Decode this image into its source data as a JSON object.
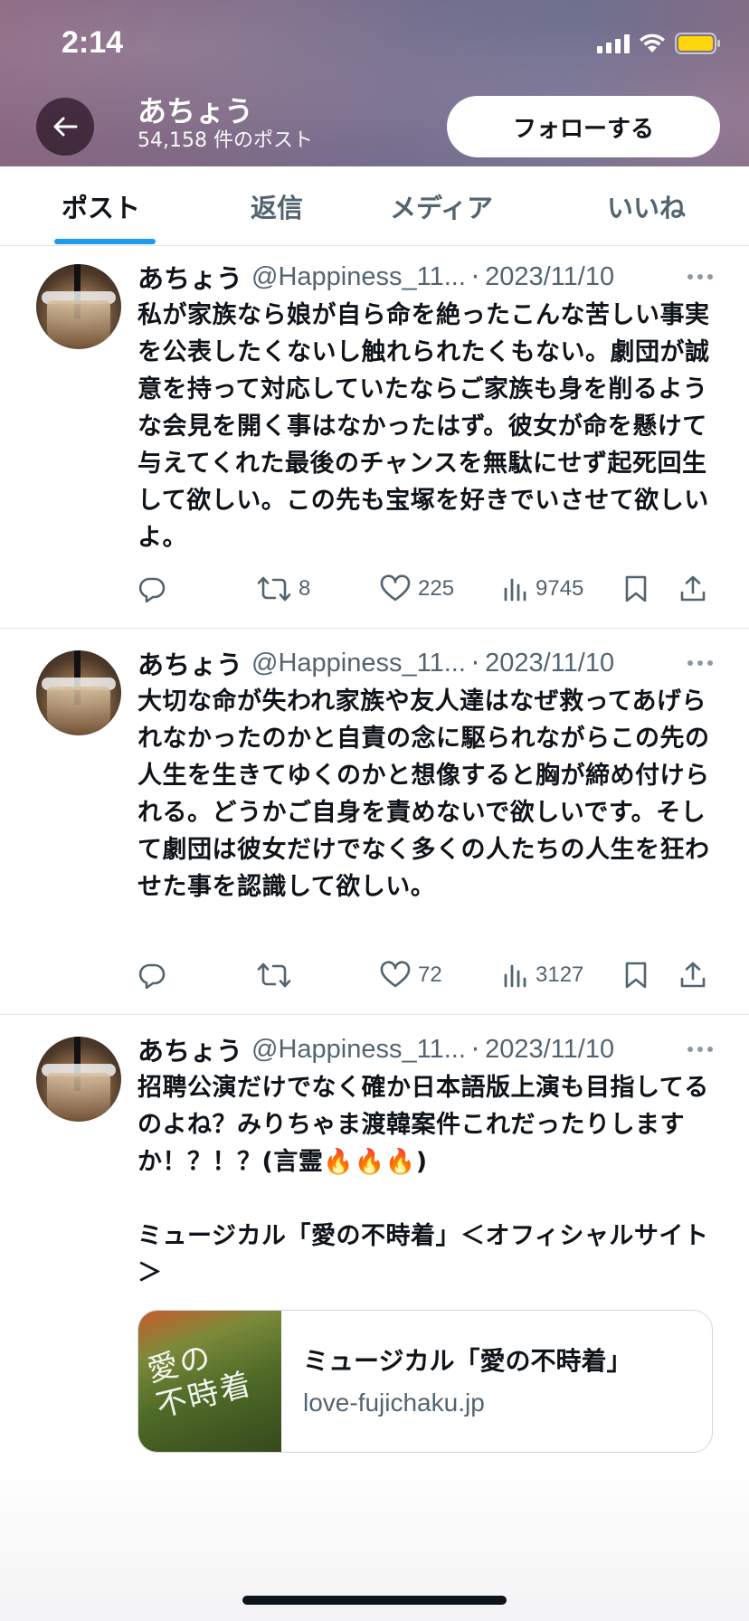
{
  "status_bar": {
    "time": "2:14"
  },
  "header": {
    "profile_name": "あちょう",
    "post_count": "54,158 件のポスト",
    "follow_label": "フォローする"
  },
  "tabs": [
    {
      "label": "ポスト",
      "active": true
    },
    {
      "label": "返信",
      "active": false
    },
    {
      "label": "メディア",
      "active": false
    },
    {
      "label": "いいね",
      "active": false
    }
  ],
  "posts": [
    {
      "author": "あちょう",
      "handle": "@Happiness_11...",
      "separator": "·",
      "date": "2023/11/10",
      "body": "私が家族なら娘が自ら命を絶ったこんな苦しい事実を公表したくないし触れられたくもない。劇団が誠意を持って対応していたならご家族も身を削るような会見を開く事はなかったはず。彼女が命を懸けて与えてくれた最後のチャンスを無駄にせず起死回生して欲しい。この先も宝塚を好きでいさせて欲しいよ。",
      "retweets": "8",
      "likes": "225",
      "views": "9745"
    },
    {
      "author": "あちょう",
      "handle": "@Happiness_11...",
      "separator": "·",
      "date": "2023/11/10",
      "body": "大切な命が失われ家族や友人達はなぜ救ってあげられなかったのかと自責の念に駆られながらこの先の人生を生きてゆくのかと想像すると胸が締め付けられる。どうかご自身を責めないで欲しいです。そして劇団は彼女だけでなく多くの人たちの人生を狂わせた事を認識して欲しい。",
      "retweets": "",
      "likes": "72",
      "views": "3127"
    },
    {
      "author": "あちょう",
      "handle": "@Happiness_11...",
      "separator": "·",
      "date": "2023/11/10",
      "body": "招聘公演だけでなく確か日本語版上演も目指してるのよね？みりちゃま渡韓案件これだったりしますか！？！？(言霊🔥🔥🔥)\n\nミュージカル「愛の不時着」＜オフィシャルサイト＞",
      "link_card": {
        "title": "ミュージカル「愛の不時着」",
        "domain": "love-fujichaku.jp",
        "thumb_text": "愛の\n不時着"
      }
    }
  ],
  "colors": {
    "accent": "#1d9bf0",
    "text_primary": "#0f1419",
    "text_secondary": "#536471"
  },
  "icons": [
    "arrow-left-icon",
    "reply-icon",
    "retweet-icon",
    "heart-icon",
    "views-icon",
    "bookmark-icon",
    "share-icon",
    "more-icon",
    "signal-icon",
    "wifi-icon",
    "battery-icon"
  ]
}
